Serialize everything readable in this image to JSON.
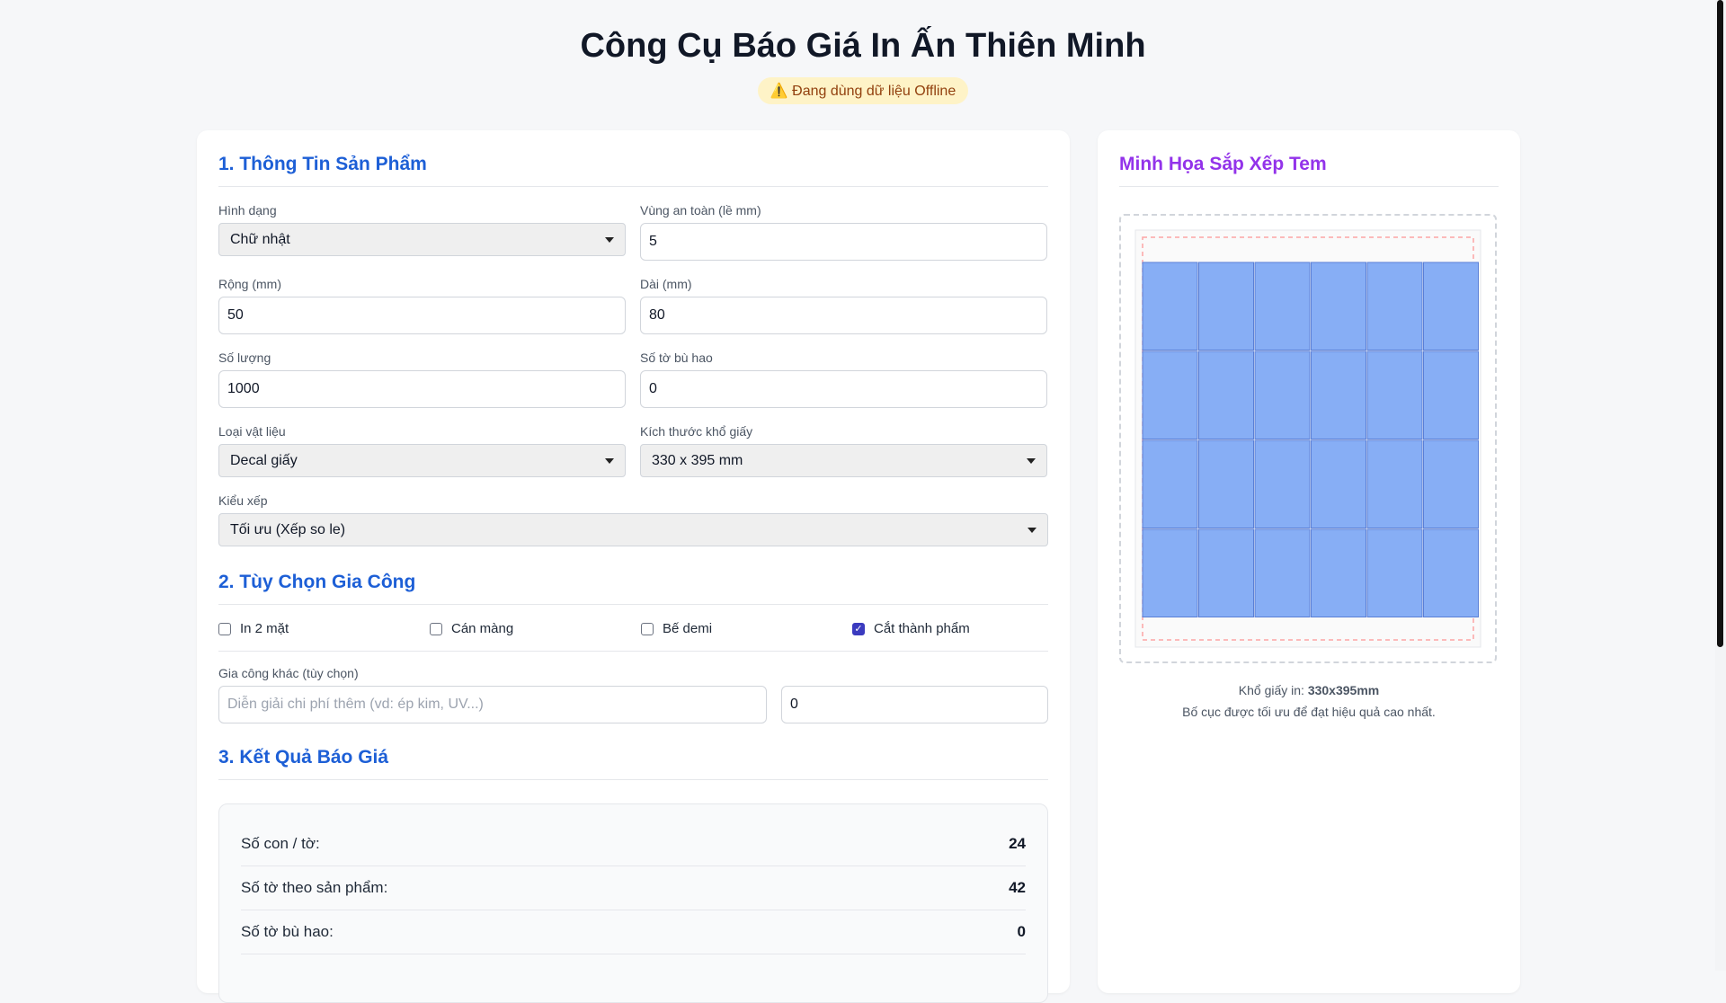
{
  "app": {
    "title": "Công Cụ Báo Giá In Ấn Thiên Minh",
    "status": "⚠️ Đang dùng dữ liệu Offline"
  },
  "product": {
    "section_title": "1. Thông Tin Sản Phẩm",
    "shape": {
      "label": "Hình dạng",
      "value": "Chữ nhật"
    },
    "safe_zone": {
      "label": "Vùng an toàn (lề mm)",
      "value": "5"
    },
    "width": {
      "label": "Rộng (mm)",
      "value": "50"
    },
    "length": {
      "label": "Dài (mm)",
      "value": "80"
    },
    "quantity": {
      "label": "Số lượng",
      "value": "1000"
    },
    "waste_sheets": {
      "label": "Số tờ bù hao",
      "value": "0"
    },
    "material": {
      "label": "Loại vật liệu",
      "value": "Decal giấy"
    },
    "paper_size": {
      "label": "Kích thước khổ giấy",
      "value": "330 x 395 mm"
    },
    "layout": {
      "label": "Kiểu xếp",
      "value": "Tối ưu (Xếp so le)"
    }
  },
  "processing": {
    "section_title": "2. Tùy Chọn Gia Công",
    "options": [
      {
        "label": "In 2 mặt",
        "checked": false
      },
      {
        "label": "Cán màng",
        "checked": false
      },
      {
        "label": "Bế demi",
        "checked": false
      },
      {
        "label": "Cắt thành phẩm",
        "checked": true
      }
    ],
    "other": {
      "label": "Gia công khác (tùy chọn)",
      "description_placeholder": "Diễn giải chi phí thêm (vd: ép kim, UV...)",
      "cost_value": "0"
    }
  },
  "result": {
    "section_title": "3. Kết Quả Báo Giá",
    "rows": [
      {
        "label": "Số con / tờ:",
        "value": "24"
      },
      {
        "label": "Số tờ theo sản phẩm:",
        "value": "42"
      },
      {
        "label": "Số tờ bù hao:",
        "value": "0"
      }
    ]
  },
  "preview": {
    "section_title": "Minh Họa Sắp Xếp Tem",
    "paper_prefix": "Khổ giấy in:",
    "paper_size": "330x395mm",
    "note": "Bố cục được tối ưu để đạt hiệu quả cao nhất.",
    "grid_cols": 6,
    "grid_rows": 4,
    "tile_color": "#87aef5",
    "tile_border": "#5a7fd6",
    "safe_zone_color": "#fca5a5"
  }
}
